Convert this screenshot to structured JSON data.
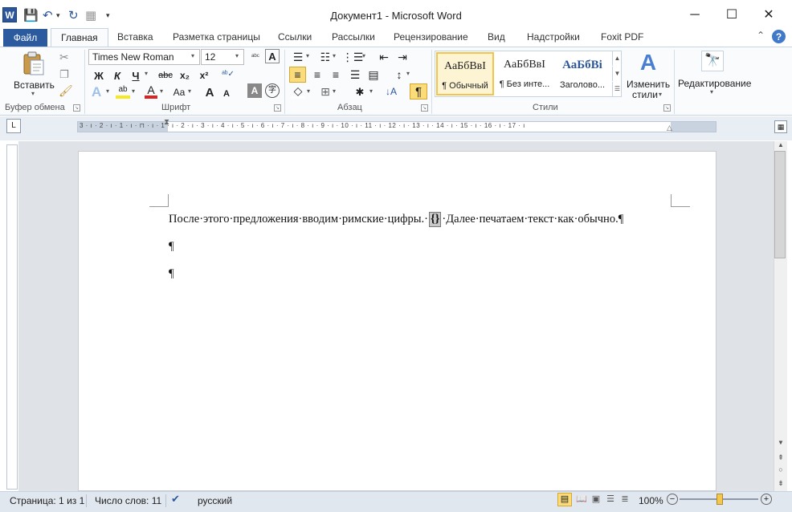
{
  "window": {
    "app_icon": "W",
    "title": "Документ1 - Microsoft Word",
    "minimize": "─",
    "maximize": "☐",
    "close": "✕"
  },
  "qat": {
    "save": "💾",
    "undo": "↶",
    "undo_arrow": "▾",
    "repeat": "↻",
    "grid": "▦",
    "customize": "▾"
  },
  "tabs": [
    "Главная",
    "Вставка",
    "Разметка страницы",
    "Ссылки",
    "Рассылки",
    "Рецензирование",
    "Вид",
    "Надстройки",
    "Foxit PDF"
  ],
  "file_tab": "Файл",
  "help": {
    "collapse": "⌃",
    "help": "?"
  },
  "clipboard": {
    "paste_label": "Вставить",
    "group": "Буфер обмена"
  },
  "font": {
    "name": "Times New Roman",
    "size": "12",
    "group": "Шрифт",
    "bold": "Ж",
    "italic": "К",
    "underline": "Ч",
    "strike": "abc",
    "sub": "x₂",
    "sup": "x²",
    "grow": "A",
    "shrink": "A",
    "case": "Aa",
    "clear": "A"
  },
  "paragraph": {
    "group": "Абзац",
    "pilcrow": "¶"
  },
  "styles": {
    "group": "Стили",
    "items": [
      {
        "sample": "АаБбВвІ",
        "name": "¶ Обычный"
      },
      {
        "sample": "АаБбВвІ",
        "name": "¶ Без инте..."
      },
      {
        "sample": "АаБбВі",
        "name": "Заголово..."
      }
    ],
    "change_label": "Изменить",
    "change_label2": "стили",
    "change_arrow": "▾"
  },
  "editing": {
    "label": "Редактирование",
    "arrow": "▾"
  },
  "ruler": {
    "ticks": "3 · ı · 2 · ı · 1 · ı · ⊓ · ı · 1 · ı · 2 · ı · 3 · ı · 4 · ı · 5 · ı · 6 · ı · 7 · ı · 8 · ı · 9 · ı · 10 · ı · 11 · ı · 12 · ı · 13 · ı · 14 · ı · 15 · ı · 16 · ı · 17 · ı"
  },
  "document": {
    "line1_pre": "После·этого·предложения·вводим·римские·цифры.·",
    "field": "{}",
    "line1_post": "·Далее·печатаем·текст·как·обычно.¶",
    "para2": "¶",
    "para3": "¶"
  },
  "status": {
    "page": "Страница: 1 из 1",
    "words": "Число слов: 11",
    "language": "русский",
    "zoom": "100%",
    "zoom_level": 0.5,
    "zoom_minus": "−",
    "zoom_plus": "+"
  }
}
